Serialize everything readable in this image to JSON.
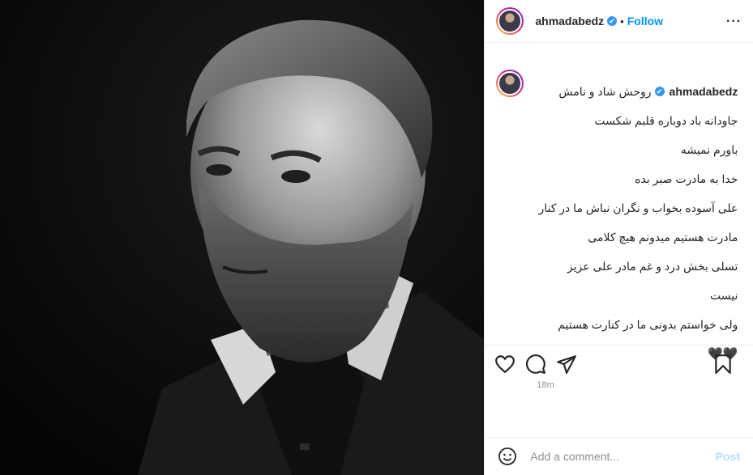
{
  "post": {
    "username": "ahmadabedz",
    "verified_mark": "✔",
    "separator": "•",
    "follow_label": "Follow",
    "more_label": "···",
    "caption_lines": [
      "روحش شاد و نامش",
      "جاودانه باد دوباره قلبم شکست",
      "باورم نمیشه",
      "خدا به مادرت صبر بده",
      "علی آسوده بخواب و نگران نباش ما در کنار",
      "مادرت هستیم میدونم هیچ کلامی",
      "تسلی بخش درد و غم مادر علی عزیز",
      "نیست",
      "ولی خواستم بدونی ما در کنارت هستیم"
    ],
    "hearts": "🖤🖤",
    "time": "18m"
  },
  "actions": {
    "like_icon": "heart-icon",
    "comment_icon": "comment-icon",
    "share_icon": "share-icon",
    "save_icon": "bookmark-icon"
  },
  "comment_box": {
    "placeholder": "Add a comment...",
    "post_label": "Post",
    "emoji_icon": "emoji-icon"
  },
  "colors": {
    "accent": "#0095f6",
    "verified": "#3897f0",
    "post_disabled": "#b2dffc"
  }
}
